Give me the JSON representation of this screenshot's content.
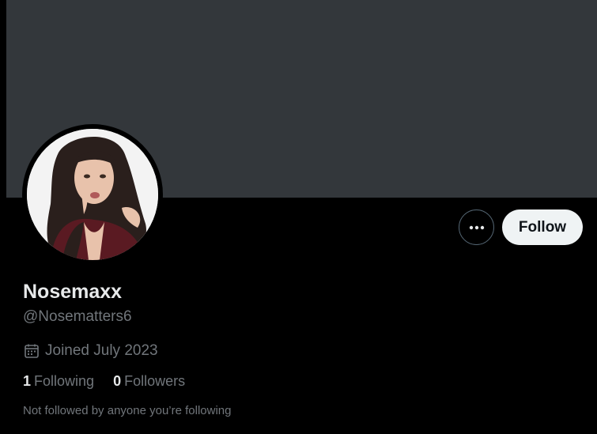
{
  "profile": {
    "display_name": "Nosemaxx",
    "handle": "@Nosematters6",
    "joined": "Joined July 2023",
    "following_count": "1",
    "following_label": "Following",
    "followers_count": "0",
    "followers_label": "Followers",
    "mutual_note": "Not followed by anyone you’re following"
  },
  "actions": {
    "follow_label": "Follow",
    "more_icon": "more-icon"
  },
  "colors": {
    "banner": "#33373b",
    "background": "#000000",
    "primary_text": "#e7e9ea",
    "secondary_text": "#71767b",
    "follow_bg": "#eff3f4"
  }
}
